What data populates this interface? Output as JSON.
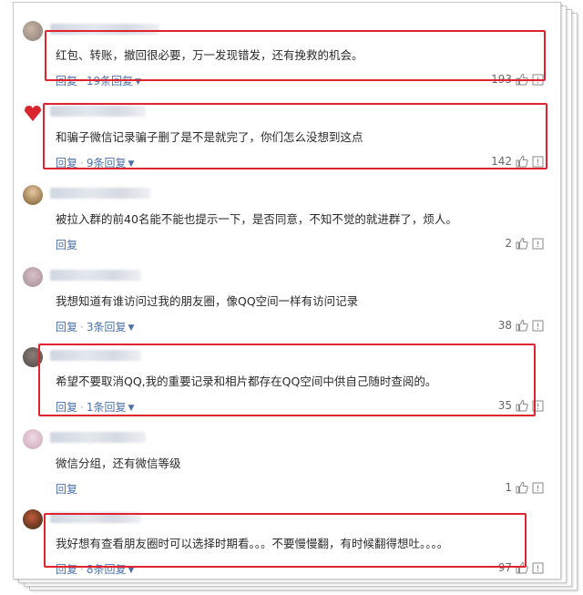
{
  "ui": {
    "reply_label": "回复",
    "separator": "·",
    "highlight_color": "#e0232e",
    "link_color": "#4d72a8"
  },
  "comments": [
    {
      "text": "红包、转账，撤回很必要，万一发现错发，还有挽救的机会。",
      "replies": "19条回复",
      "likes": "193",
      "highlighted": true
    },
    {
      "text": "和骗子微信记录骗子删了是不是就完了，你们怎么没想到这点",
      "replies": "9条回复",
      "likes": "142",
      "highlighted": true
    },
    {
      "text": "被拉入群的前40名能不能也提示一下，是否同意，不知不觉的就进群了，烦人。",
      "replies": "",
      "likes": "2",
      "highlighted": false
    },
    {
      "text": "我想知道有谁访问过我的朋友圈，像QQ空间一样有访问记录",
      "replies": "3条回复",
      "likes": "38",
      "highlighted": false
    },
    {
      "text": "希望不要取消QQ,我的重要记录和相片都存在QQ空间中供自己随时查阅的。",
      "replies": "1条回复",
      "likes": "35",
      "highlighted": true
    },
    {
      "text": "微信分组，还有微信等级",
      "replies": "",
      "likes": "1",
      "highlighted": false
    },
    {
      "text": "我好想有查看朋友圈时可以选择时期看。。。不要慢慢翻，有时候翻得想吐。。。。",
      "replies": "8条回复",
      "likes": "97",
      "highlighted": true
    }
  ],
  "icons": {
    "like": "thumbs-up-icon",
    "report": "report-icon",
    "expand": "chevron-down-icon"
  }
}
